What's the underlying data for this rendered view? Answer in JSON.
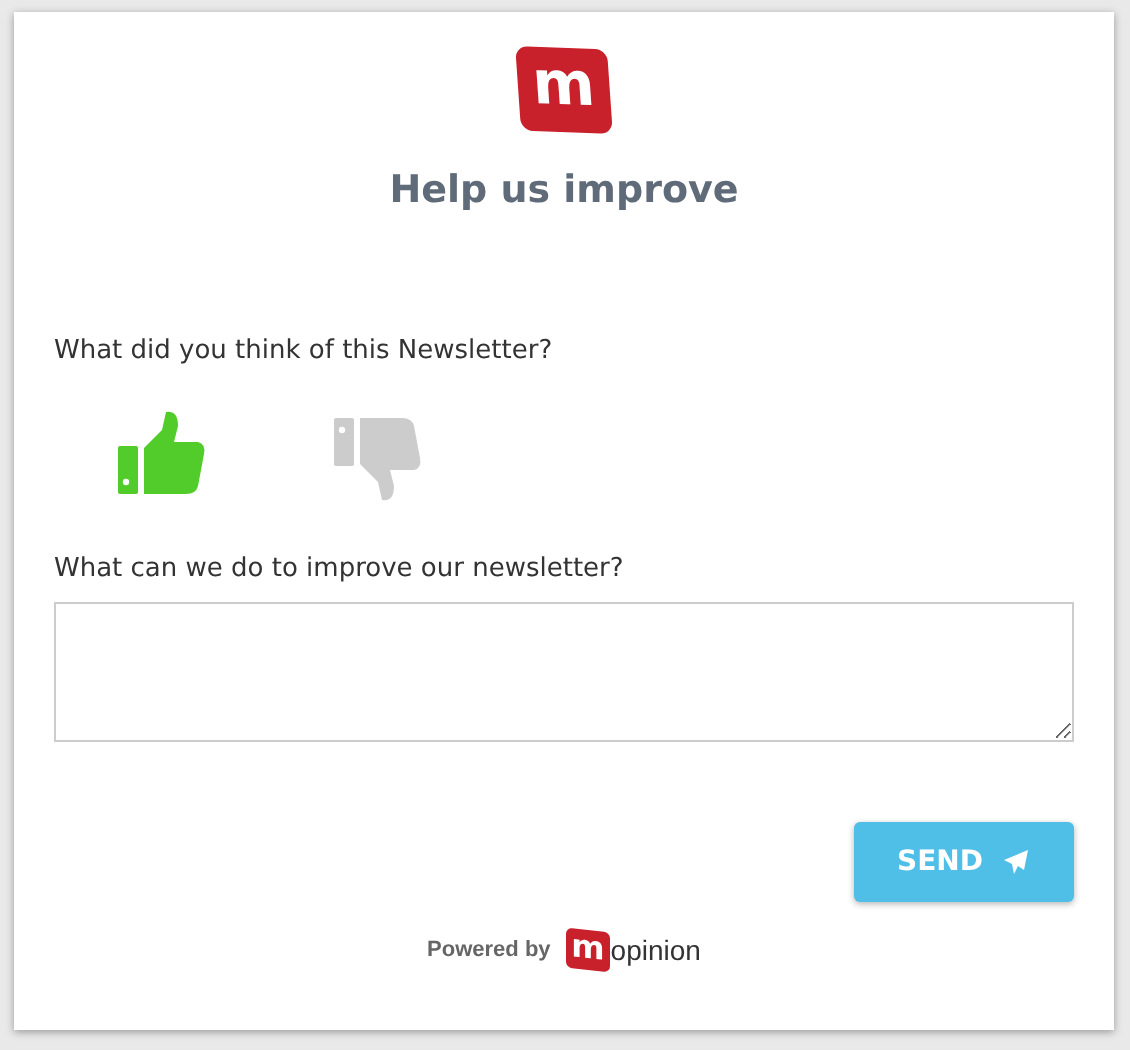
{
  "logo": {
    "letter": "m"
  },
  "title": "Help us improve",
  "questions": [
    {
      "kind": "thumbs",
      "label": "What did you think of this Newsletter?",
      "options": [
        {
          "kind": "up",
          "selected": true
        },
        {
          "kind": "down",
          "selected": false
        }
      ]
    },
    {
      "kind": "text",
      "label": "What can we do to improve our newsletter?"
    }
  ],
  "send_button": "SEND",
  "footer": {
    "powered_by": "Powered by",
    "brand_letter": "m",
    "brand_rest": "opinion"
  }
}
